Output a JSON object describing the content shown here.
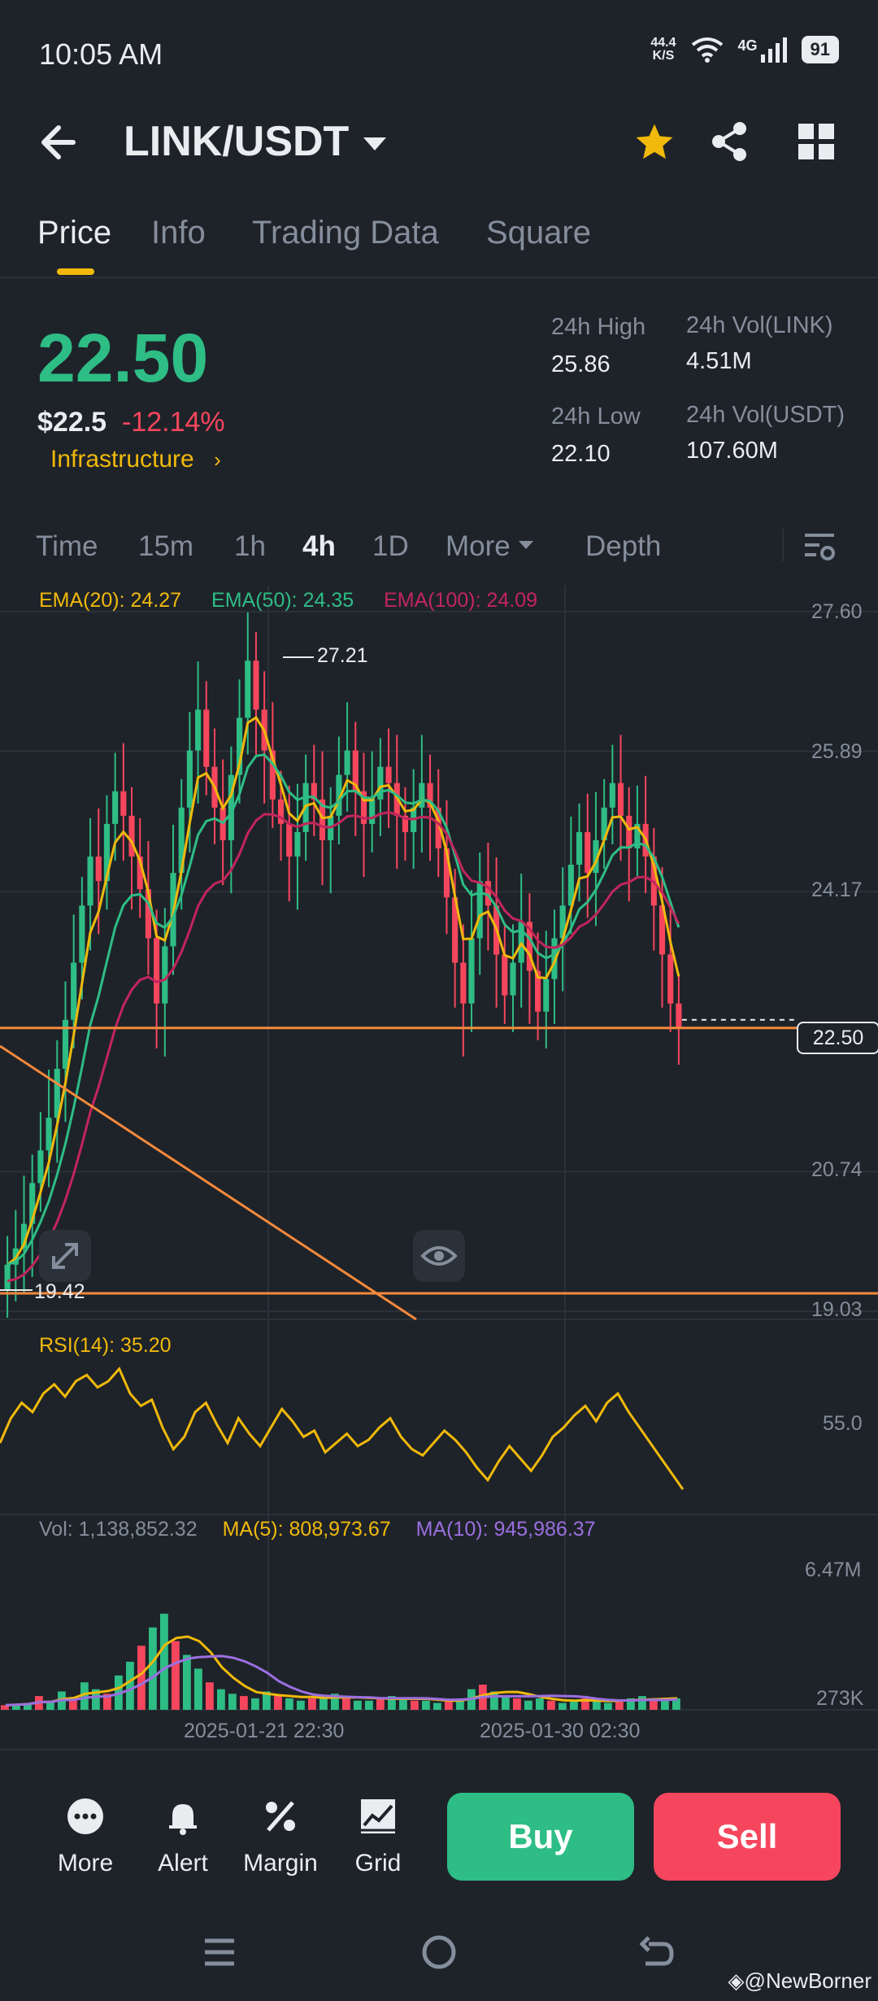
{
  "status_bar": {
    "time": "10:05 AM",
    "net_speed_value": "44.4",
    "net_speed_unit": "K/S",
    "network_type": "4G",
    "battery": "91"
  },
  "header": {
    "pair": "LINK/USDT",
    "back_icon": "arrow-left-icon",
    "favorite_icon": "star-icon",
    "share_icon": "share-icon",
    "menu_icon": "grid-icon",
    "favorite_color": "#f0b90b"
  },
  "tabs": [
    {
      "label": "Price",
      "active": true
    },
    {
      "label": "Info",
      "active": false
    },
    {
      "label": "Trading Data",
      "active": false
    },
    {
      "label": "Square",
      "active": false
    }
  ],
  "ticker": {
    "price": "22.50",
    "price_usd": "$22.5",
    "change": "-12.14%",
    "category": "Infrastructure",
    "stats": {
      "high_label": "24h High",
      "high_value": "25.86",
      "low_label": "24h Low",
      "low_value": "22.10",
      "vol_base_label": "24h Vol(LINK)",
      "vol_base_value": "4.51M",
      "vol_quote_label": "24h Vol(USDT)",
      "vol_quote_value": "107.60M"
    }
  },
  "intervals": [
    {
      "label": "Time",
      "active": false
    },
    {
      "label": "15m",
      "active": false
    },
    {
      "label": "1h",
      "active": false
    },
    {
      "label": "4h",
      "active": true
    },
    {
      "label": "1D",
      "active": false
    },
    {
      "label": "More",
      "active": false
    },
    {
      "label": "Depth",
      "active": false
    }
  ],
  "indicators": {
    "ema20": "EMA(20): 24.27",
    "ema50": "EMA(50): 24.35",
    "ema100": "EMA(100): 24.09",
    "rsi": "RSI(14): 35.20",
    "vol": "Vol: 1,138,852.32",
    "ma5": "MA(5): 808,973.67",
    "ma10": "MA(10): 945,986.37"
  },
  "chart_data": {
    "type": "candlestick",
    "pair": "LINK/USDT",
    "interval": "4h",
    "price_axis_ticks": [
      "27.60",
      "25.89",
      "24.17",
      "20.74",
      "19.03"
    ],
    "ylim": [
      19.03,
      27.6
    ],
    "high_marker": "27.21",
    "low_marker": "19.42",
    "last_price": "22.50",
    "rsi_axis_tick": "55.0",
    "volume_axis_ticks": [
      "6.47M",
      "273K"
    ],
    "x_ticks": [
      "2025-01-21 22:30",
      "2025-01-30 02:30"
    ],
    "colors": {
      "up": "#2ebd85",
      "down": "#f6465d",
      "ema20": "#f0b90b",
      "ema50": "#2ebd85",
      "ema100": "#c2255c",
      "ma10": "#9b6fe0",
      "trendline": "#f5893b"
    },
    "close_series": [
      19.6,
      19.8,
      20.1,
      20.6,
      21.0,
      21.4,
      22.0,
      22.6,
      23.3,
      24.0,
      24.6,
      24.3,
      25.0,
      25.4,
      25.1,
      24.6,
      24.2,
      23.6,
      22.8,
      23.5,
      24.4,
      25.2,
      25.9,
      26.4,
      25.7,
      25.2,
      24.8,
      25.6,
      26.3,
      27.0,
      26.4,
      25.9,
      25.3,
      25.0,
      24.6,
      24.9,
      25.5,
      25.3,
      24.8,
      25.1,
      25.6,
      25.9,
      25.4,
      25.0,
      25.3,
      25.7,
      25.5,
      25.1,
      24.9,
      25.2,
      25.5,
      25.2,
      24.7,
      24.1,
      23.3,
      22.8,
      23.6,
      24.3,
      24.0,
      23.4,
      22.9,
      23.3,
      23.8,
      23.2,
      22.7,
      23.1,
      23.6,
      24.0,
      24.5,
      24.9,
      24.4,
      24.8,
      25.2,
      25.5,
      25.1,
      24.7,
      25.0,
      24.6,
      24.0,
      23.4,
      22.8,
      22.5
    ],
    "rsi_series": [
      50,
      58,
      63,
      60,
      66,
      69,
      65,
      70,
      72,
      68,
      70,
      74,
      66,
      62,
      64,
      55,
      48,
      52,
      60,
      63,
      56,
      50,
      58,
      53,
      49,
      55,
      61,
      57,
      52,
      54,
      47,
      50,
      53,
      49,
      51,
      55,
      58,
      52,
      48,
      46,
      50,
      54,
      51,
      47,
      42,
      38,
      44,
      49,
      45,
      41,
      46,
      52,
      55,
      59,
      62,
      57,
      63,
      66,
      60,
      55,
      50,
      45,
      40,
      35
    ],
    "volume_series": [
      0.2,
      0.25,
      0.3,
      0.6,
      0.4,
      0.8,
      0.5,
      1.2,
      0.9,
      0.7,
      1.5,
      2.1,
      2.8,
      3.6,
      4.2,
      3.0,
      2.4,
      1.8,
      1.2,
      0.9,
      0.7,
      0.6,
      0.5,
      0.8,
      0.6,
      0.5,
      0.4,
      0.5,
      0.6,
      0.7,
      0.5,
      0.4,
      0.4,
      0.5,
      0.6,
      0.5,
      0.4,
      0.4,
      0.3,
      0.4,
      0.5,
      0.9,
      1.1,
      0.8,
      0.6,
      0.5,
      0.4,
      0.5,
      0.4,
      0.3,
      0.4,
      0.5,
      0.4,
      0.3,
      0.4,
      0.5,
      0.6,
      0.5,
      0.4,
      0.5
    ]
  },
  "toolbar": {
    "more": "More",
    "alert": "Alert",
    "margin": "Margin",
    "grid": "Grid",
    "buy": "Buy",
    "sell": "Sell"
  },
  "credit": "@NewBorner"
}
